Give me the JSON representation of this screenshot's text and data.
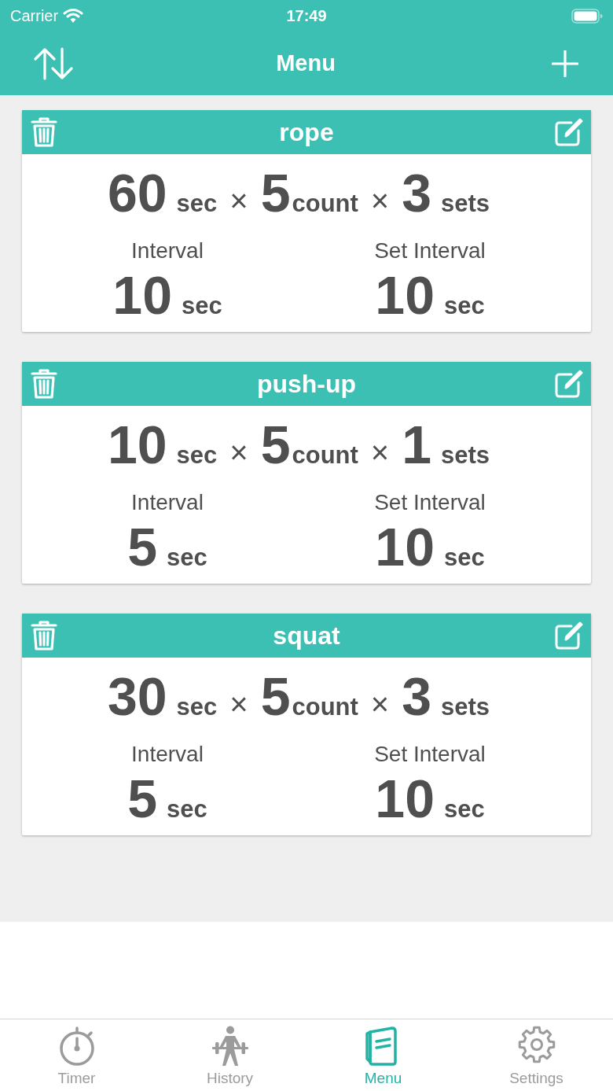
{
  "status_bar": {
    "carrier": "Carrier",
    "time": "17:49"
  },
  "nav_bar": {
    "title": "Menu"
  },
  "menus": [
    {
      "name": "rope",
      "work": {
        "value": "60",
        "unit": "sec"
      },
      "times_1": "×",
      "count": {
        "value": "5",
        "unit": "count"
      },
      "times_2": "×",
      "sets": {
        "value": "3",
        "unit": "sets"
      },
      "interval": {
        "label": "Interval",
        "value": "10",
        "unit": "sec"
      },
      "set_interval": {
        "label": "Set Interval",
        "value": "10",
        "unit": "sec"
      }
    },
    {
      "name": "push-up",
      "work": {
        "value": "10",
        "unit": "sec"
      },
      "times_1": "×",
      "count": {
        "value": "5",
        "unit": "count"
      },
      "times_2": "×",
      "sets": {
        "value": "1",
        "unit": "sets"
      },
      "interval": {
        "label": "Interval",
        "value": "5",
        "unit": "sec"
      },
      "set_interval": {
        "label": "Set Interval",
        "value": "10",
        "unit": "sec"
      }
    },
    {
      "name": "squat",
      "work": {
        "value": "30",
        "unit": "sec"
      },
      "times_1": "×",
      "count": {
        "value": "5",
        "unit": "count"
      },
      "times_2": "×",
      "sets": {
        "value": "3",
        "unit": "sets"
      },
      "interval": {
        "label": "Interval",
        "value": "5",
        "unit": "sec"
      },
      "set_interval": {
        "label": "Set Interval",
        "value": "10",
        "unit": "sec"
      }
    }
  ],
  "tab_bar": [
    {
      "label": "Timer",
      "kind": "stopwatch",
      "selected": false
    },
    {
      "label": "History",
      "kind": "weightlifter",
      "selected": false
    },
    {
      "label": "Menu",
      "kind": "booklet",
      "selected": true
    },
    {
      "label": "Settings",
      "kind": "gear",
      "selected": false
    }
  ]
}
